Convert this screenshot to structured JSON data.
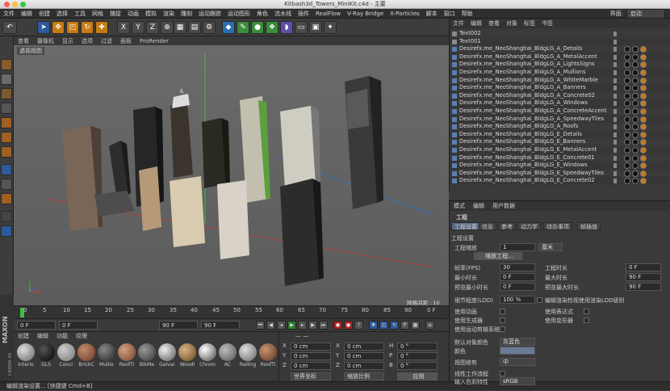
{
  "window": {
    "title": "Kitbash3d_Towers_MiniKit.c4d - 主要"
  },
  "menubar": {
    "items": [
      "文件",
      "编辑",
      "创建",
      "选择",
      "工具",
      "网格",
      "捕捉",
      "动画",
      "模拟",
      "渲染",
      "雕刻",
      "运动跟踪",
      "运动图形",
      "角色",
      "流水线",
      "插件",
      "RealFlow",
      "V-Ray Bridge",
      "X-Particles",
      "脚本",
      "窗口",
      "帮助"
    ],
    "layout_label": "界面:",
    "layout_value": "启动"
  },
  "viewport": {
    "menu": [
      "查看",
      "摄像机",
      "显示",
      "选项",
      "过滤",
      "面板",
      "ProRender"
    ],
    "label": "透视视图",
    "grid_text": "网格间距 : 10 cm"
  },
  "timeline": {
    "ticks": [
      "0",
      "5",
      "10",
      "15",
      "20",
      "25",
      "30",
      "35",
      "40",
      "45",
      "50",
      "55",
      "60",
      "65",
      "70",
      "75",
      "80",
      "85",
      "90"
    ],
    "frame_end": "0 F"
  },
  "transport": {
    "start": "0 F",
    "current": "0 F",
    "end": "90 F",
    "end2": "90 F"
  },
  "materials": {
    "menu": [
      "创建",
      "编辑",
      "功能",
      "纹理"
    ],
    "items": [
      "Interio",
      "GLS",
      "Concr",
      "BrickC",
      "Mullio",
      "RoofTi",
      "BlkMe",
      "Galvar",
      "WoodI",
      "Chrom",
      "AC",
      "Railing",
      "RoofTi"
    ]
  },
  "coords": {
    "header": "— —",
    "rows": [
      {
        "a": "X",
        "v1": "0 cm",
        "b": "X",
        "v2": "0 cm",
        "c": "H",
        "v3": "0 °"
      },
      {
        "a": "Y",
        "v1": "0 cm",
        "b": "Y",
        "v2": "0 cm",
        "c": "P",
        "v3": "0 °"
      },
      {
        "a": "Z",
        "v1": "0 cm",
        "b": "Z",
        "v2": "0 cm",
        "c": "B",
        "v3": "0 °"
      }
    ],
    "mode1": "世界坐标",
    "mode2": "缩放比例",
    "apply": "应用"
  },
  "status": {
    "text": "编辑渲染设置... [快捷键 Cmd+B]"
  },
  "maxon": {
    "brand": "MAXON",
    "sub": "CINEMA 4D"
  },
  "objects": {
    "menu": [
      "文件",
      "编辑",
      "查看",
      "对象",
      "标签",
      "书签"
    ],
    "rows": [
      "Text002",
      "Text001",
      "Desirefx.me_NeoShanghai_BldgLG_A_Details",
      "Desirefx.me_NeoShanghai_BldgLG_A_MetalAccent",
      "Desirefx.me_NeoShanghai_BldgLG_A_LightsSigns",
      "Desirefx.me_NeoShanghai_BldgLG_A_Mullions",
      "Desirefx.me_NeoShanghai_BldgLG_A_WhiteMarble",
      "Desirefx.me_NeoShanghai_BldgLG_A_Banners",
      "Desirefx.me_NeoShanghai_BldgLG_A_Concrete02",
      "Desirefx.me_NeoShanghai_BldgLG_A_Windows",
      "Desirefx.me_NeoShanghai_BldgLG_A_ConcreteAccent",
      "Desirefx.me_NeoShanghai_BldgLG_A_SpeedwayTiles",
      "Desirefx.me_NeoShanghai_BldgLG_A_Roofs",
      "Desirefx.me_NeoShanghai_BldgLG_E_Details",
      "Desirefx.me_NeoShanghai_BldgLG_E_Banners",
      "Desirefx.me_NeoShanghai_BldgLG_E_MetalAccent",
      "Desirefx.me_NeoShanghai_BldgLG_E_Concrete01",
      "Desirefx.me_NeoShanghai_BldgLG_E_Windows",
      "Desirefx.me_NeoShanghai_BldgLG_E_SpeedwayTiles",
      "Desirefx.me_NeoShanghai_BldgLG_E_Concrete02"
    ]
  },
  "attributes": {
    "menu": [
      "模式",
      "编辑",
      "用户数据"
    ],
    "title": "工程",
    "tabs": [
      "工程设置",
      "信息",
      "参考",
      "动力学",
      "待办事项",
      "帧插值"
    ],
    "section": "工程设置",
    "scale_label": "工程缩放",
    "scale_value": "1",
    "scale_unit": "厘米",
    "scale_btn": "缩放工程...",
    "fps_label": "帧率(FPS)",
    "fps": "30",
    "proj_time_label": "工程时长",
    "proj_time": "0 F",
    "min_label": "最小时长",
    "min": "0 F",
    "max_label": "最大时长",
    "max": "90 F",
    "pmin_label": "预览最小时长",
    "pmin": "0 F",
    "pmax_label": "预览最大时长",
    "pmax": "90 F",
    "lod_label": "细节程度(LOD)",
    "lod": "100 %",
    "lod_check": "编辑渲染检视使用渲染LOD级别",
    "anim_label": "使用动画",
    "expr_label": "使用表达式",
    "gen_label": "使用生成器",
    "deform_label": "使用变形器",
    "mograph_label": "使用运动剪辑系统",
    "objcolor_label": "默认对象颜色",
    "objcolor": "灰蓝色",
    "color_label": "颜色",
    "clip_label": "视图修剪",
    "clip": "中",
    "linear_label": "线性工作流程",
    "input_label": "输入色彩特性",
    "input": "sRGB"
  }
}
